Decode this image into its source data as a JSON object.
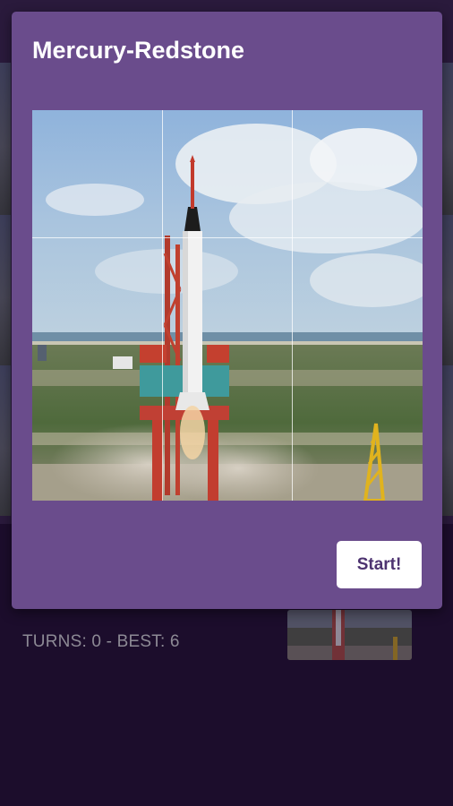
{
  "modal": {
    "title": "Mercury-Redstone",
    "start_label": "Start!",
    "grid": {
      "rows": 3,
      "cols": 3
    }
  },
  "status": {
    "text": "TURNS: 0 - BEST: 6",
    "turns": 0,
    "best": 6
  },
  "colors": {
    "page_background": "#1c0d2c",
    "modal_background": "#6a4c8c",
    "button_text": "#4d3370",
    "status_text": "#8d8a95"
  }
}
